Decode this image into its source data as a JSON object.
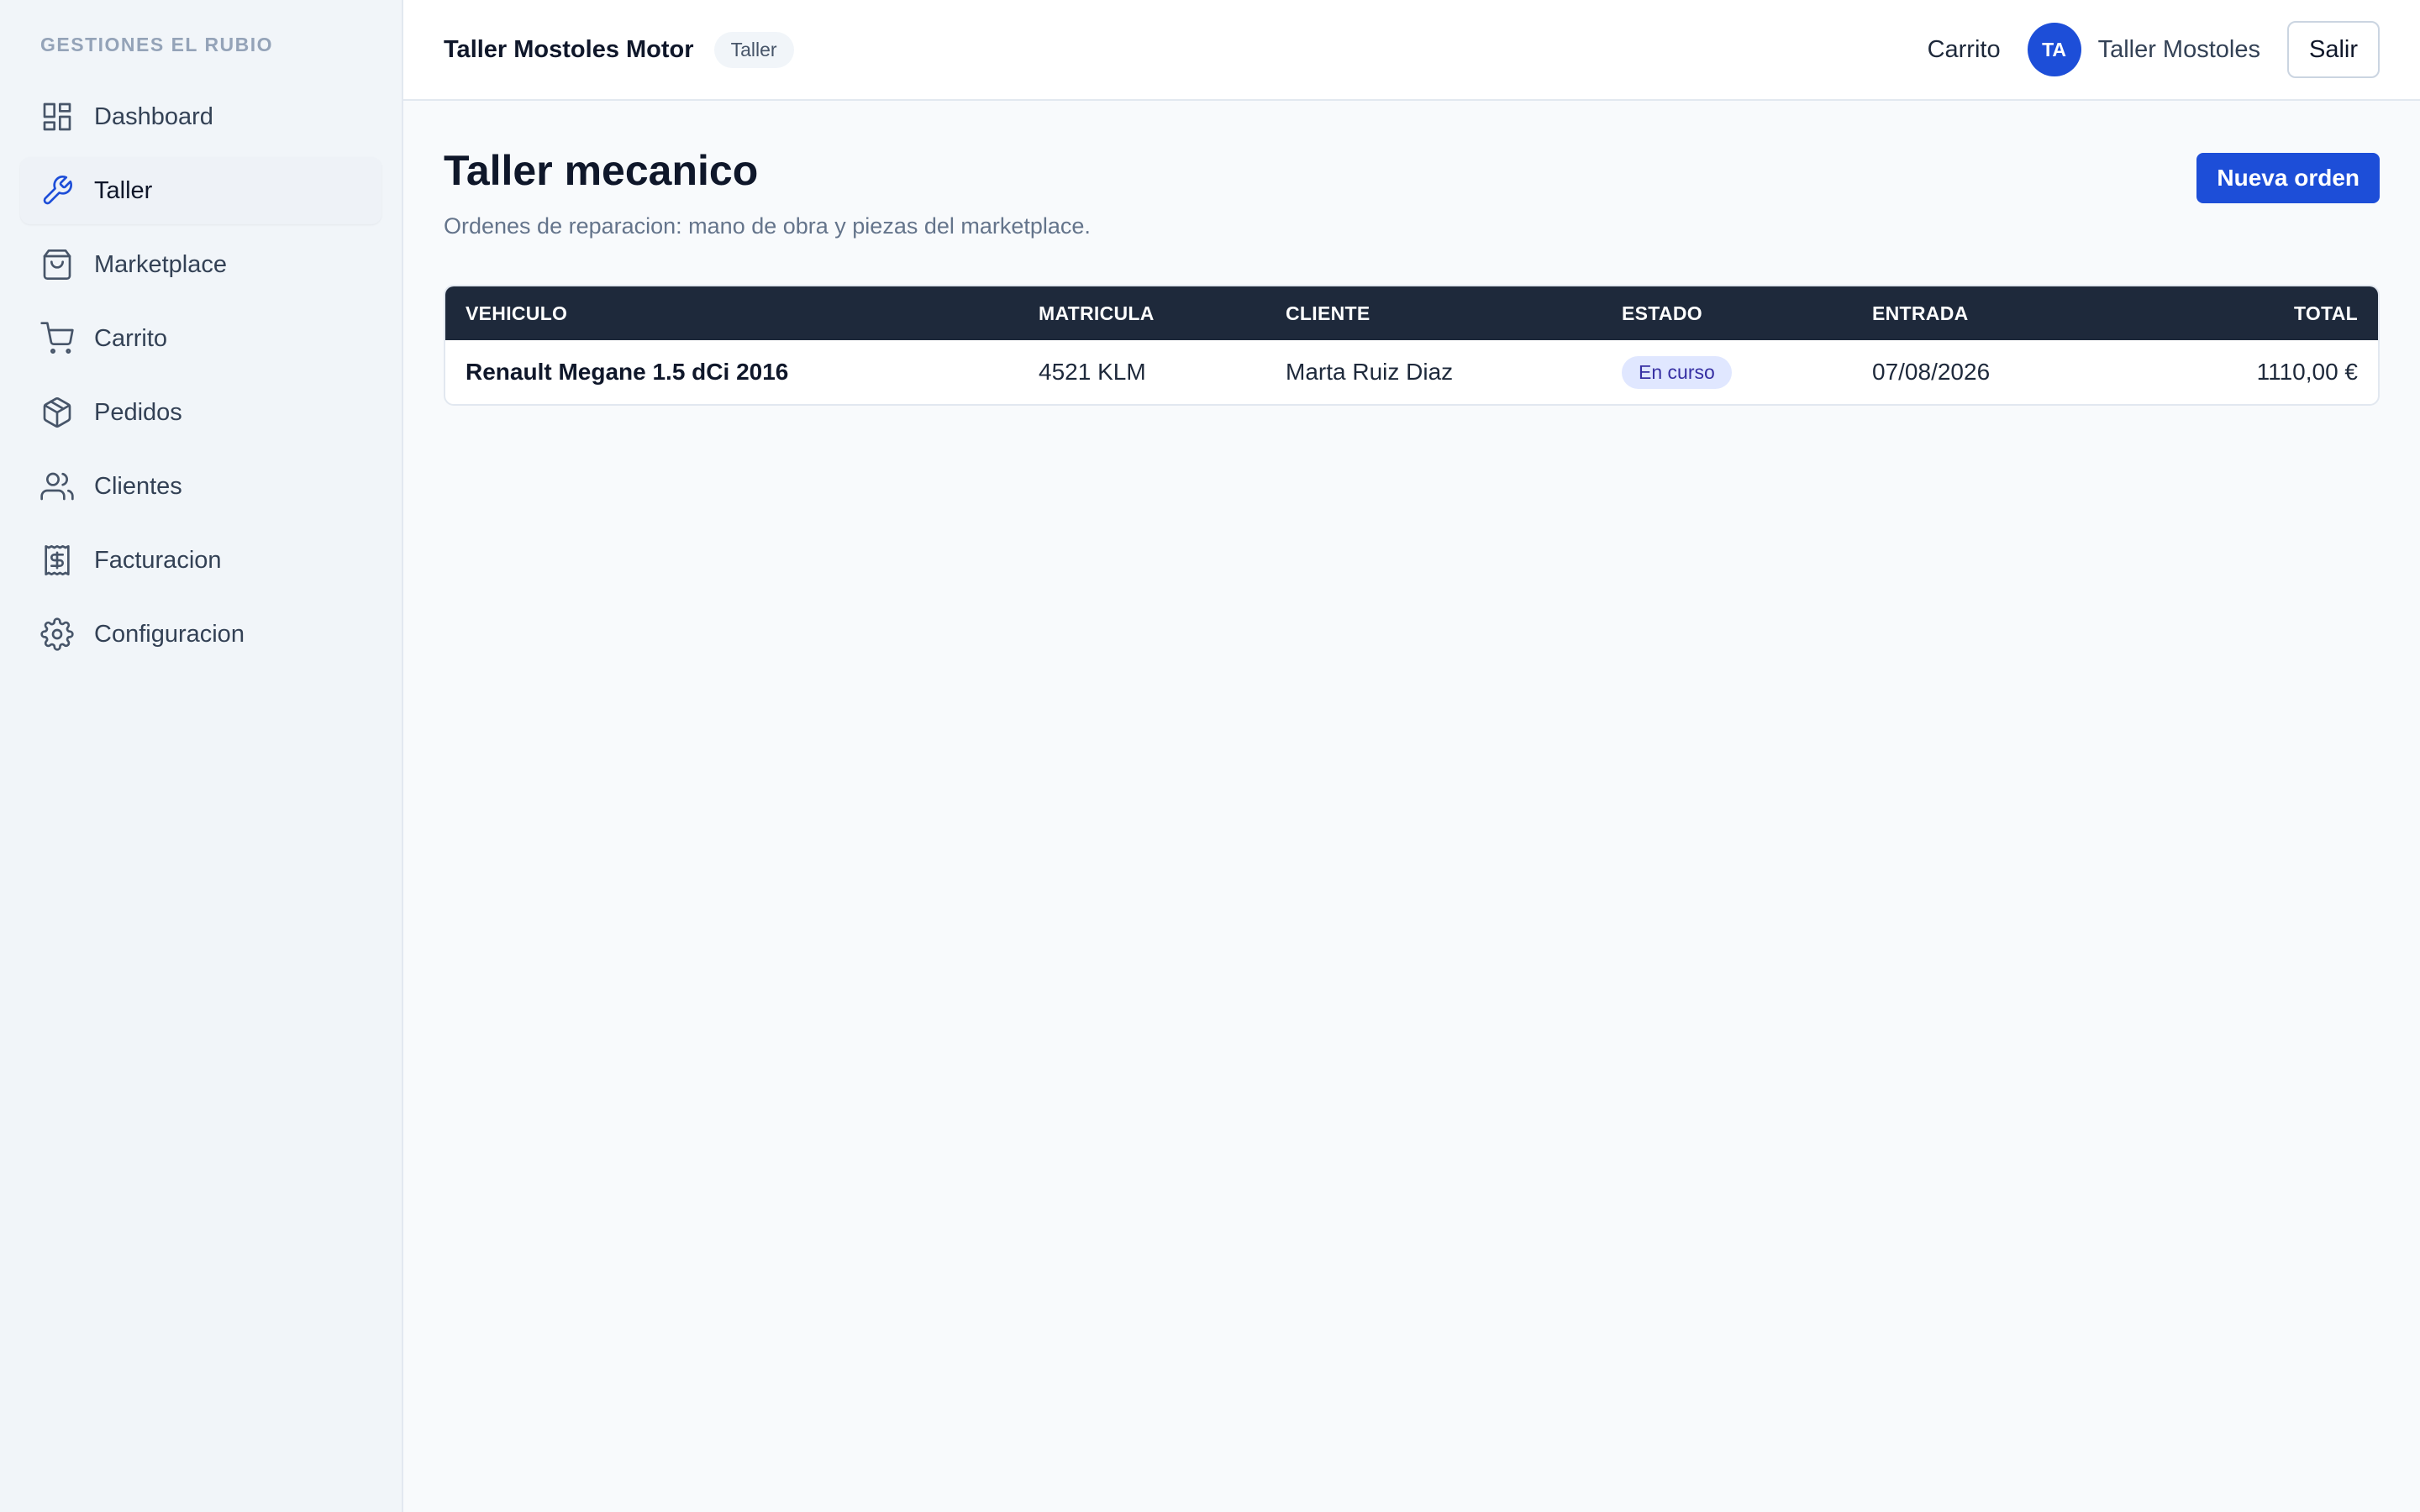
{
  "sidebar": {
    "brand": "GESTIONES EL RUBIO",
    "items": [
      {
        "label": "Dashboard",
        "icon": "dashboard-icon"
      },
      {
        "label": "Taller",
        "icon": "wrench-icon",
        "active": true
      },
      {
        "label": "Marketplace",
        "icon": "shopping-bag-icon"
      },
      {
        "label": "Carrito",
        "icon": "cart-icon"
      },
      {
        "label": "Pedidos",
        "icon": "package-icon"
      },
      {
        "label": "Clientes",
        "icon": "users-icon"
      },
      {
        "label": "Facturacion",
        "icon": "receipt-icon"
      },
      {
        "label": "Configuracion",
        "icon": "gear-icon"
      }
    ]
  },
  "header": {
    "company": "Taller Mostoles Motor",
    "role_badge": "Taller",
    "cart_label": "Carrito",
    "avatar_initials": "TA",
    "user_name": "Taller Mostoles",
    "logout_label": "Salir"
  },
  "main": {
    "title": "Taller mecanico",
    "subtitle": "Ordenes de reparacion: mano de obra y piezas del marketplace.",
    "new_order_label": "Nueva orden",
    "table": {
      "columns": [
        "VEHICULO",
        "MATRICULA",
        "CLIENTE",
        "ESTADO",
        "ENTRADA",
        "TOTAL"
      ],
      "rows": [
        {
          "vehicle": "Renault Megane 1.5 dCi 2016",
          "plate": "4521 KLM",
          "client": "Marta Ruiz Diaz",
          "status": "En curso",
          "entry": "07/08/2026",
          "total": "1110,00 €"
        }
      ]
    }
  },
  "colors": {
    "accent": "#1d4ed8",
    "table_header": "#1e293b",
    "status_bg": "#e0e7ff",
    "status_text": "#3730a3"
  }
}
